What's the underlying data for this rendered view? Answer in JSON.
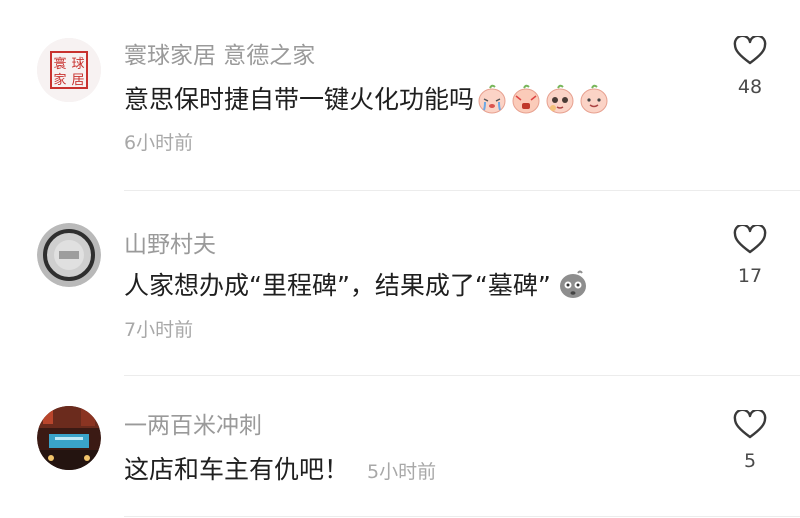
{
  "comments": [
    {
      "username": "寰球家居 意德之家",
      "avatar_text": [
        "寰",
        "球",
        "家",
        "居"
      ],
      "text": "意思保时捷自带一键火化功能吗",
      "emojis": [
        "crying-peach-emoji",
        "shocked-peach-emoji",
        "pleading-peach-emoji",
        "smiling-peach-emoji"
      ],
      "time": "6小时前",
      "likes": "48",
      "avatar": "logo-seal-avatar"
    },
    {
      "username": "山野村夫",
      "text": "人家想办成“里程碑”，结果成了“墓碑”",
      "emojis": [
        "dizzy-face-emoji"
      ],
      "time": "7小时前",
      "likes": "17",
      "avatar": "gray-photo-avatar"
    },
    {
      "username": "一两百米冲刺",
      "text": "这店和车主有仇吧！",
      "time": "5小时前",
      "likes": "5",
      "avatar": "night-street-avatar"
    }
  ],
  "icons": {
    "like": "heart-outline-icon"
  },
  "colors": {
    "username": "#9a9a9a",
    "text": "#1f1f1f",
    "time": "#a8a8a8",
    "divider": "#ececec"
  }
}
